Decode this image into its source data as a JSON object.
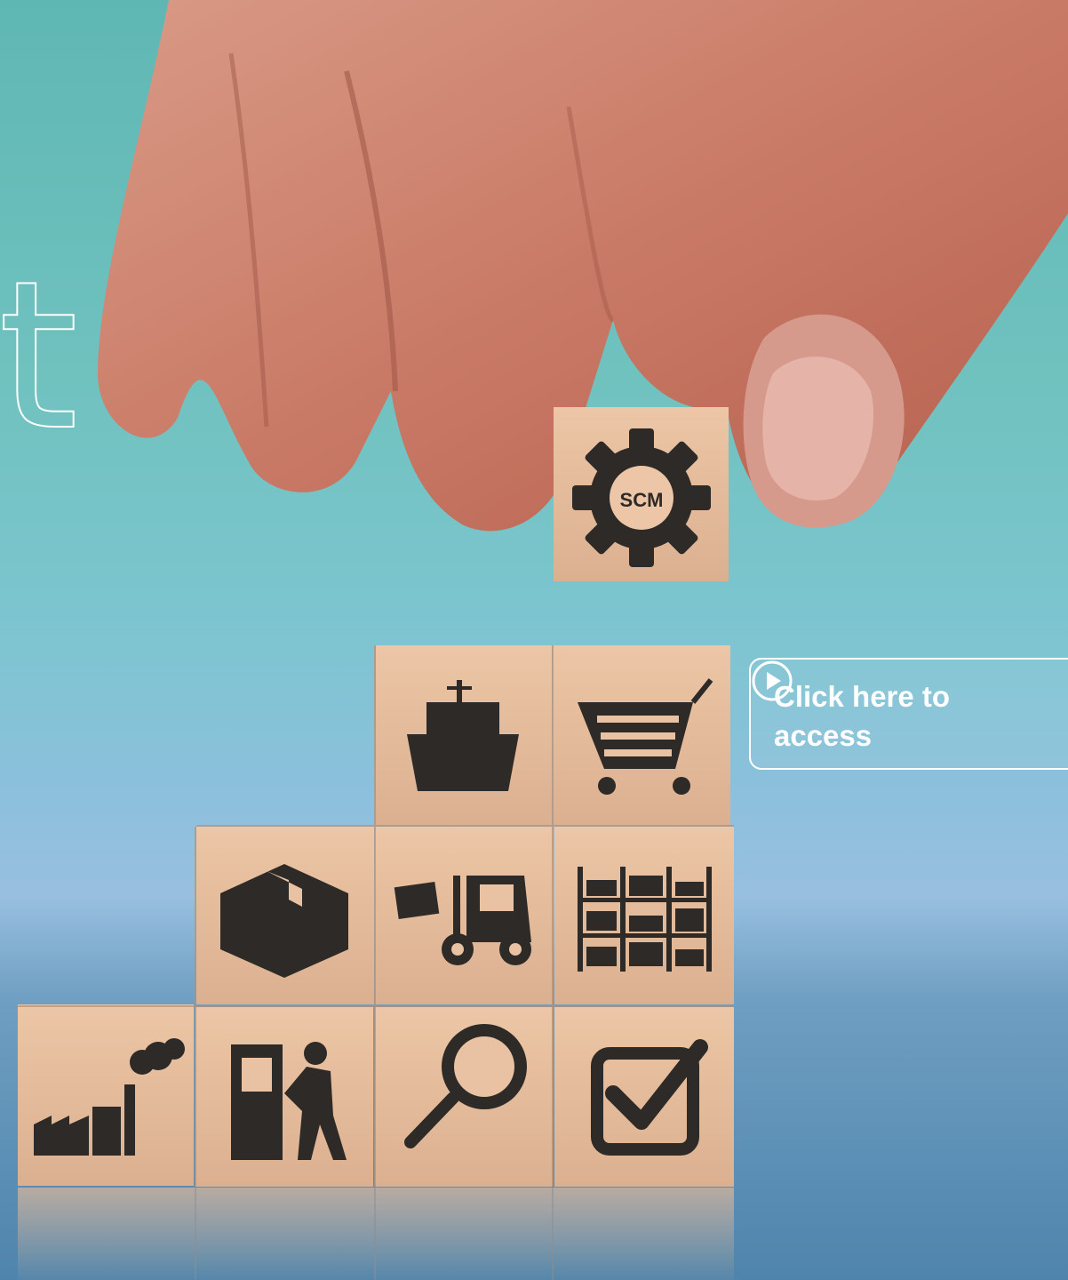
{
  "hero": {
    "title_fragment": "t",
    "block_badge": "SCM"
  },
  "cta": {
    "label": "Click here to access",
    "icon": "play-circle-icon"
  },
  "blocks": [
    {
      "icon": "gear-icon"
    },
    {
      "icon": "cargo-ship-icon"
    },
    {
      "icon": "shopping-cart-icon"
    },
    {
      "icon": "package-box-icon"
    },
    {
      "icon": "forklift-icon"
    },
    {
      "icon": "warehouse-shelves-icon"
    },
    {
      "icon": "factory-icon"
    },
    {
      "icon": "worker-machine-icon"
    },
    {
      "icon": "magnifier-icon"
    },
    {
      "icon": "checkbox-icon"
    }
  ],
  "colors": {
    "background_top": "#5fb7b3",
    "background_bottom": "#4f84ac",
    "wood": "#e6bd9b",
    "icon": "#2d2a27",
    "cta_border": "#ffffff"
  }
}
